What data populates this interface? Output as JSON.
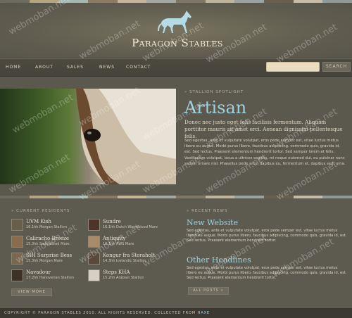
{
  "colors": {
    "stripes": [
      "#6d6b5e",
      "#b7a481",
      "#a6b8b0",
      "#8d7b61",
      "#c7b59a",
      "#a3a8a4",
      "#7e7666",
      "#bfb49c",
      "#9aa3a3",
      "#6b5e4f",
      "#c8bca6",
      "#8e9b98"
    ],
    "accent": "#9fd1dd"
  },
  "header": {
    "brand": "Paragon Stables"
  },
  "nav": {
    "items": [
      "HOME",
      "ABOUT",
      "SALES",
      "NEWS",
      "CONTACT"
    ]
  },
  "search": {
    "value": "",
    "button_label": "SEARCH"
  },
  "feature": {
    "label": "» STALLION SPOTLIGHT",
    "title": "Artisan",
    "intro": "Donec nec justo eget felis facilisis fermentum. Aliquam porttitor mauris sit amet orci. Aenean dignissim pellentesque felis.",
    "body": "Sed egestas, ante et vulputate volutpat, eros pede semper est, vitae luctus metus libero eu augue. Morbi purus libero, faucibus adipiscing, commodo quis, gravida id, est. Sed lectus. Praesent elementum hendrerit tortor. Sed semper lorem at felis. Vestibulum volutpat, lacus a ultrices sagittis, mi neque euismod dui, eu pulvinar nunc sapien ornare nisl. Phasellus pede arcu, dapibus eu, fermentum et, dapibus sed, urna."
  },
  "residents": {
    "label": "» CURRENT RESIDENTS",
    "items": [
      {
        "name": "UVM Kish",
        "desc": "16.1hh Morgan Stallion"
      },
      {
        "name": "Sundre",
        "desc": "16.1hh Dutch Warmblood Mare"
      },
      {
        "name": "Caliracho Breeze",
        "desc": "15.3hh Saddlebred Mare"
      },
      {
        "name": "Antiquity",
        "desc": "16.1hh AWS Mare"
      },
      {
        "name": "SIH Surprise Bess",
        "desc": "15.3hh Morgan Mare"
      },
      {
        "name": "Kongur fra Storaholt",
        "desc": "14.3hh Icelandic Stallion"
      },
      {
        "name": "Navadour",
        "desc": "17.2hh Hanoverian Stallion"
      },
      {
        "name": "Steps KHA",
        "desc": "15.2hh Arabian Stallion"
      }
    ],
    "button_label": "VIEW MORE"
  },
  "news": {
    "label": "» RECENT NEWS",
    "items": [
      {
        "title": "New Website",
        "text": "Sed egestas, ante et vulputate volutpat, eros pede semper est, vitae luctus metus libero eu augue. Morbi purus libero, faucibus adipiscing, commodo quis, gravida id, est. Sed lectus. Praesent elementum hendrerit tortor."
      },
      {
        "title": "Other Headlines",
        "text": "Sed egestas, ante et vulputate volutpat, eros pede semper est, vitae luctus metus libero eu augue. Morbi purus libero, faucibus adipiscing, commodo quis, gravida id, est. Sed lectus. Praesent elementum hendrerit tortor."
      }
    ],
    "button_label": "ALL POSTS »"
  },
  "footer": {
    "text": "COPYRIGHT © PARAGON STABLES 2010. ALL RIGHTS RESERVED. COLLECTED FROM ",
    "link": "HAXE"
  },
  "watermark": "webmoban.net"
}
